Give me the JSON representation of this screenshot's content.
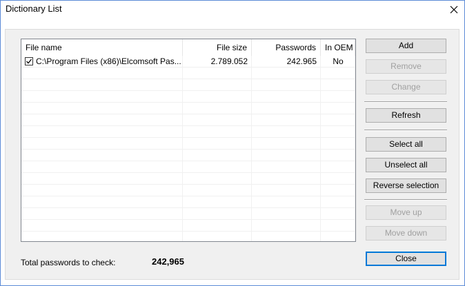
{
  "window": {
    "title": "Dictionary List"
  },
  "list": {
    "columns": [
      "File name",
      "File size",
      "Passwords",
      "In OEM"
    ],
    "rows": [
      {
        "checked": true,
        "file_name": "C:\\Program Files (x86)\\Elcomsoft Pas...",
        "file_size": "2.789.052",
        "passwords": "242.965",
        "in_oem": "No"
      }
    ]
  },
  "buttons": {
    "add": "Add",
    "remove": "Remove",
    "change": "Change",
    "refresh": "Refresh",
    "select_all": "Select all",
    "unselect_all": "Unselect all",
    "reverse_selection": "Reverse selection",
    "move_up": "Move up",
    "move_down": "Move down",
    "close": "Close"
  },
  "footer": {
    "total_label": "Total passwords to check:",
    "total_value": "242,965"
  }
}
